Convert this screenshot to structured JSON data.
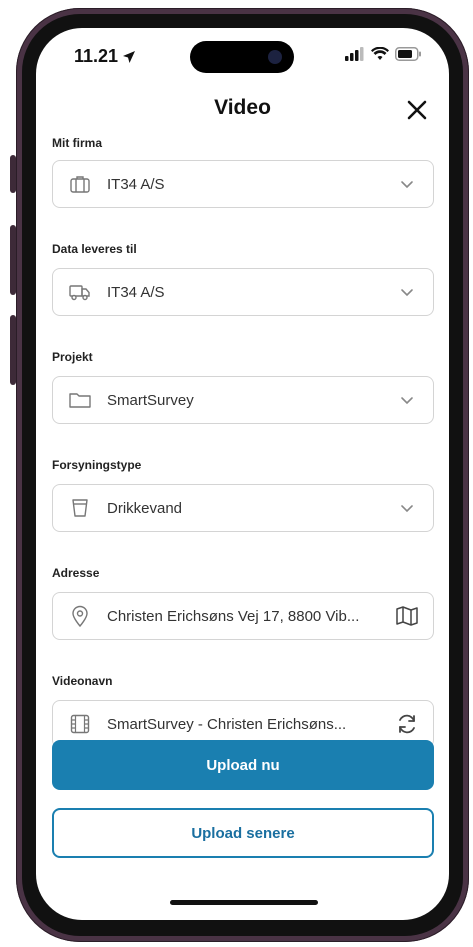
{
  "status_bar": {
    "time": "11.21"
  },
  "header": {
    "title": "Video"
  },
  "form": {
    "company": {
      "label": "Mit firma",
      "value": "IT34 A/S"
    },
    "delivered_to": {
      "label": "Data leveres til",
      "value": "IT34 A/S"
    },
    "project": {
      "label": "Projekt",
      "value": "SmartSurvey"
    },
    "supply_type": {
      "label": "Forsyningstype",
      "value": "Drikkevand"
    },
    "address": {
      "label": "Adresse",
      "value": "Christen Erichsøns Vej 17, 8800 Vib..."
    },
    "video_name": {
      "label": "Videonavn",
      "value": "SmartSurvey  - Christen Erichsøns..."
    }
  },
  "actions": {
    "upload_now": "Upload nu",
    "upload_later": "Upload senere"
  },
  "colors": {
    "accent": "#1a7fb0",
    "frame": "#4a3345"
  }
}
